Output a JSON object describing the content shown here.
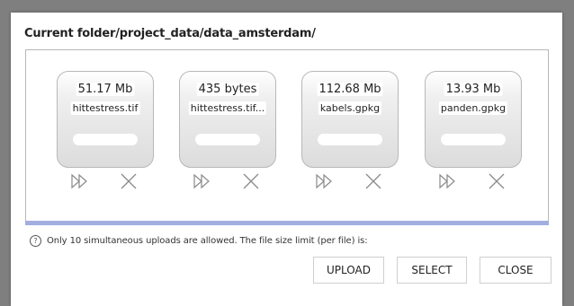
{
  "dialog": {
    "title": "Current folder/project_data/data_amsterdam/"
  },
  "files": [
    {
      "size": "51.17 Mb",
      "name": "hittestress.tif"
    },
    {
      "size": "435 bytes",
      "name": "hittestress.tif..."
    },
    {
      "size": "112.68 Mb",
      "name": "kabels.gpkg"
    },
    {
      "size": "13.93 Mb",
      "name": "panden.gpkg"
    }
  ],
  "icons": {
    "start": "fast-forward-icon",
    "remove": "close-icon",
    "info": "help-circle-icon"
  },
  "info": {
    "icon_glyph": "?",
    "text": "Only 10 simultaneous uploads are allowed. The file size limit (per file) is:"
  },
  "buttons": {
    "upload": "UPLOAD",
    "select": "SELECT",
    "close": "CLOSE"
  },
  "colors": {
    "progress_bar": "#a3aee0",
    "backdrop": "#7f7f7f"
  }
}
